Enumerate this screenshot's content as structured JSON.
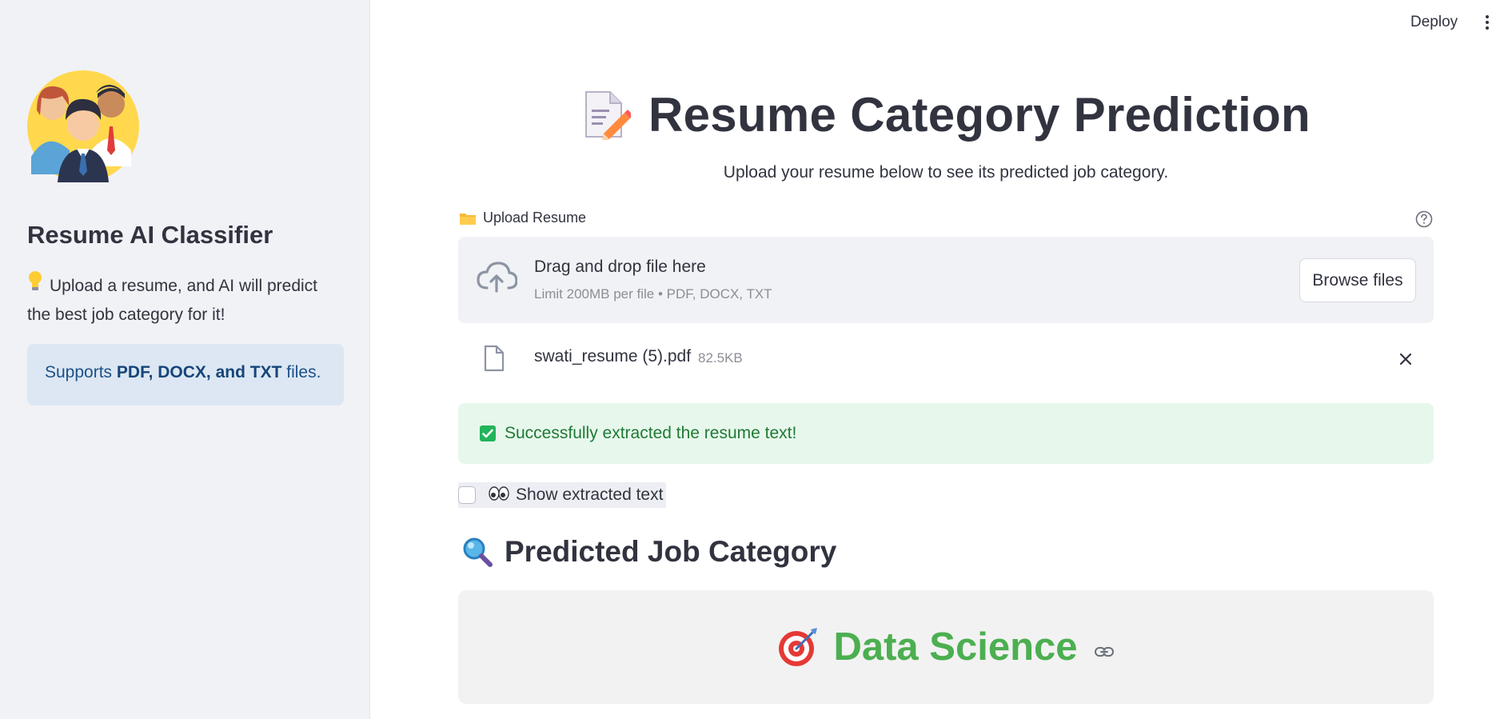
{
  "header": {
    "deploy_label": "Deploy",
    "menu_icon": "kebab-menu-icon"
  },
  "sidebar": {
    "avatar_icon": "team-avatar-illustration",
    "title": "Resume AI Classifier",
    "description": "Upload a resume, and AI will predict the best job category for it!",
    "description_icon": "lightbulb-icon",
    "info": {
      "prefix": "Supports ",
      "bold": "PDF, DOCX, and TXT",
      "suffix": " files."
    }
  },
  "main": {
    "title": "Resume Category Prediction",
    "title_icon": "memo-pencil-icon",
    "subtitle": "Upload your resume below to see its predicted job category.",
    "uploader": {
      "label": "Upload Resume",
      "label_icon": "folder-icon",
      "dropzone_text": "Drag and drop file here",
      "limit_text": "Limit 200MB per file • PDF, DOCX, TXT",
      "browse_label": "Browse files"
    },
    "uploaded_file": {
      "name": "swati_resume (5).pdf",
      "size": "82.5KB"
    },
    "success_message": "Successfully extracted the resume text!",
    "show_text_checkbox": {
      "label": "Show extracted text",
      "checked": false
    },
    "prediction": {
      "heading": "Predicted Job Category",
      "heading_icon": "magnifying-glass-icon",
      "value": "Data Science",
      "value_icon": "direct-hit-target-icon"
    }
  },
  "colors": {
    "sidebar_bg": "#f0f2f6",
    "info_bg": "#dce7f3",
    "success_bg": "#e7f7ec",
    "success_text": "#1f7a34",
    "prediction_green": "#4caf50",
    "text": "#31333f"
  }
}
